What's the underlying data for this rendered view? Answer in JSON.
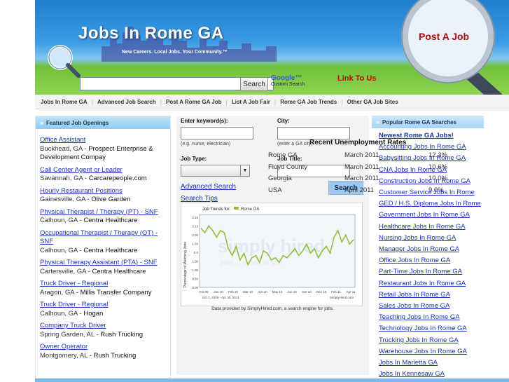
{
  "header": {
    "site_title": "Jobs In Rome GA",
    "tagline": "New Careers.  Local Jobs.  Your Community.™",
    "post_job": "Post A Job",
    "search_button": "Search",
    "google_label": "Google™",
    "custom_search": "Custom Search",
    "link_to_us": "Link To Us"
  },
  "nav": [
    "Jobs In Rome GA",
    "Advanced Job Search",
    "Post A Rome GA Job",
    "List A Job Fair",
    "Rome GA Job Trends",
    "Other GA Job Sites"
  ],
  "featured": {
    "heading": "Featured Job Openings",
    "jobs": [
      {
        "title": "Office Assistant",
        "location": "Buckhead, GA",
        "company": "Prospect Enterprise & Development Compay"
      },
      {
        "title": "Call Center Agent or Leader",
        "location": "Savannah, GA",
        "company": "Carcarepeople.com"
      },
      {
        "title": "Hourly Restaurant Positions",
        "location": "Gainesville, GA",
        "company": "Olive Garden"
      },
      {
        "title": "Physical Therapist / Therapy (PT) - SNF",
        "location": "Calhoun, GA",
        "company": "Centra Healthcare"
      },
      {
        "title": "Occupational Therapist / Therapy (OT) - SNF",
        "location": "Calhoun, GA",
        "company": "Centra Healthcare"
      },
      {
        "title": "Physical Therapy Assistant (PTA) - SNF",
        "location": "Cartersville, GA",
        "company": "Centra Healthcare"
      },
      {
        "title": "Truck Driver - Regional",
        "location": "Aragon, GA",
        "company": "Millis Transfer Company"
      },
      {
        "title": "Truck Driver - Regional",
        "location": "Calhoun, GA",
        "company": "Hogan"
      },
      {
        "title": "Company Truck Driver",
        "location": "Spring Garden, AL",
        "company": "Rush Trucking"
      },
      {
        "title": "Owner Operator",
        "location": "Montgomery, AL",
        "company": "Rush Trucking"
      }
    ]
  },
  "search_form": {
    "keyword_label": "Enter keyword(s):",
    "keyword_hint": "(e.g. nurse, electrician)",
    "city_label": "City:",
    "city_hint": "(enter a GA city)",
    "job_type_label": "Job Type:",
    "job_title_label": "Job Title:",
    "search_button": "Search",
    "advanced_link": "Advanced Search",
    "tips_link": "Search Tips"
  },
  "unemployment": {
    "title": "Recent Unemployment Rates",
    "rows": [
      {
        "area": "Rome GA",
        "month": "March 2011",
        "rate": "12.3%"
      },
      {
        "area": "Floyd County",
        "month": "March 2011",
        "rate": "10.6%"
      },
      {
        "area": "Georgia",
        "month": "March 2011",
        "rate": "10.0%"
      },
      {
        "area": "USA",
        "month": "April 2011",
        "rate": "9.0%"
      }
    ]
  },
  "chart_data": {
    "type": "line",
    "title": "Job Trends for:",
    "legend": "Rome GA",
    "ylabel": "Percentage of Matching Jobs",
    "watermark": "simply hired",
    "watermark_sub": "jobs ... made simple",
    "y_ticks": [
      "3.15",
      "3.13",
      "3.00",
      "2.50",
      "0.0",
      "1.00",
      "1.00",
      "0.50",
      "0.00"
    ],
    "x_ticks": [
      "Oct 05",
      "Jan 10",
      "Feb 10",
      "Mar 10",
      "Apr 10",
      "May 10",
      "Jun 10",
      "Oct 10",
      "Dec 10",
      "Feb 11",
      "Apr 11"
    ],
    "x_range": "Oct 1, 2009 - Apr 30, 2011",
    "brand": "SimplyHired.com",
    "ylim": [
      0,
      3.2
    ],
    "series": [
      {
        "name": "Rome GA",
        "color": "#8fbf3a",
        "values": [
          2.6,
          2.4,
          2.7,
          2.5,
          2.2,
          2.5,
          2.4,
          1.7,
          1.4,
          1.8,
          1.2,
          1.5,
          1.0,
          1.3,
          1.4,
          1.1,
          1.6,
          1.5,
          1.2,
          1.3,
          1.1,
          1.4,
          1.3,
          1.5,
          1.7,
          1.4,
          1.6,
          1.9,
          1.5,
          1.7,
          1.3,
          1.6,
          1.8,
          1.5,
          2.2,
          2.5,
          2.0,
          2.3,
          1.9,
          2.1
        ]
      }
    ],
    "credit": "Data provided by SimplyHired.com, a search engine for jobs."
  },
  "popular": {
    "heading": "Popular Rome GA Searches",
    "links": [
      "Newest Rome GA Jobs!",
      "Accounting Jobs In Rome GA",
      "Babysitting Jobs In Rome GA",
      "CNA Jobs In Rome GA",
      "Construction Jobs In Rome GA",
      "Customer Service Jobs In Rome",
      "GED / H.S. Diploma Jobs In Rome",
      "Government Jobs In Rome GA",
      "Healthcare Jobs In Rome GA",
      "Nursing Jobs In Rome GA",
      "Manager Jobs In Rome GA",
      "Office Jobs In Rome GA",
      "Part-Time Jobs In Rome GA",
      "Restaurant Jobs In Rome GA",
      "Retail Jobs In Rome GA",
      "Sales Jobs In Rome GA",
      "Teaching Jobs In Rome GA",
      "Technology Jobs In Rome GA",
      "Trucking Jobs In Rome GA",
      "Warehouse Jobs In Rome GA",
      "Jobs In Marietta GA",
      "Jobs In Kennesaw GA"
    ]
  }
}
